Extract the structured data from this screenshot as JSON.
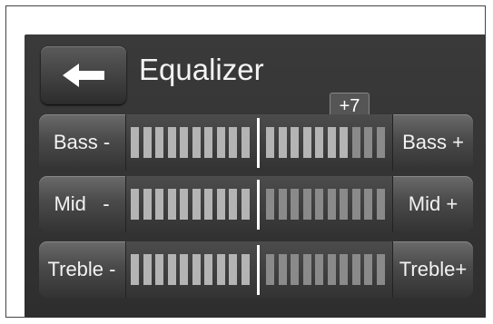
{
  "header": {
    "title": "Equalizer",
    "back_icon": "arrow-left-icon"
  },
  "bands": [
    {
      "id": "bass",
      "minus_label": "Bass -",
      "plus_label": "Bass +",
      "value": 7,
      "value_label": "+7"
    },
    {
      "id": "mid",
      "minus_label": "Mid   -",
      "plus_label": "Mid +",
      "value": 0
    },
    {
      "id": "treble",
      "minus_label": "Treble -",
      "plus_label": "Treble+",
      "value": 0
    }
  ],
  "colors": {
    "segment_active": "#b4b4b4",
    "segment_inactive": "#8a8a8a",
    "center_line": "#ffffff",
    "background": "#333333"
  }
}
